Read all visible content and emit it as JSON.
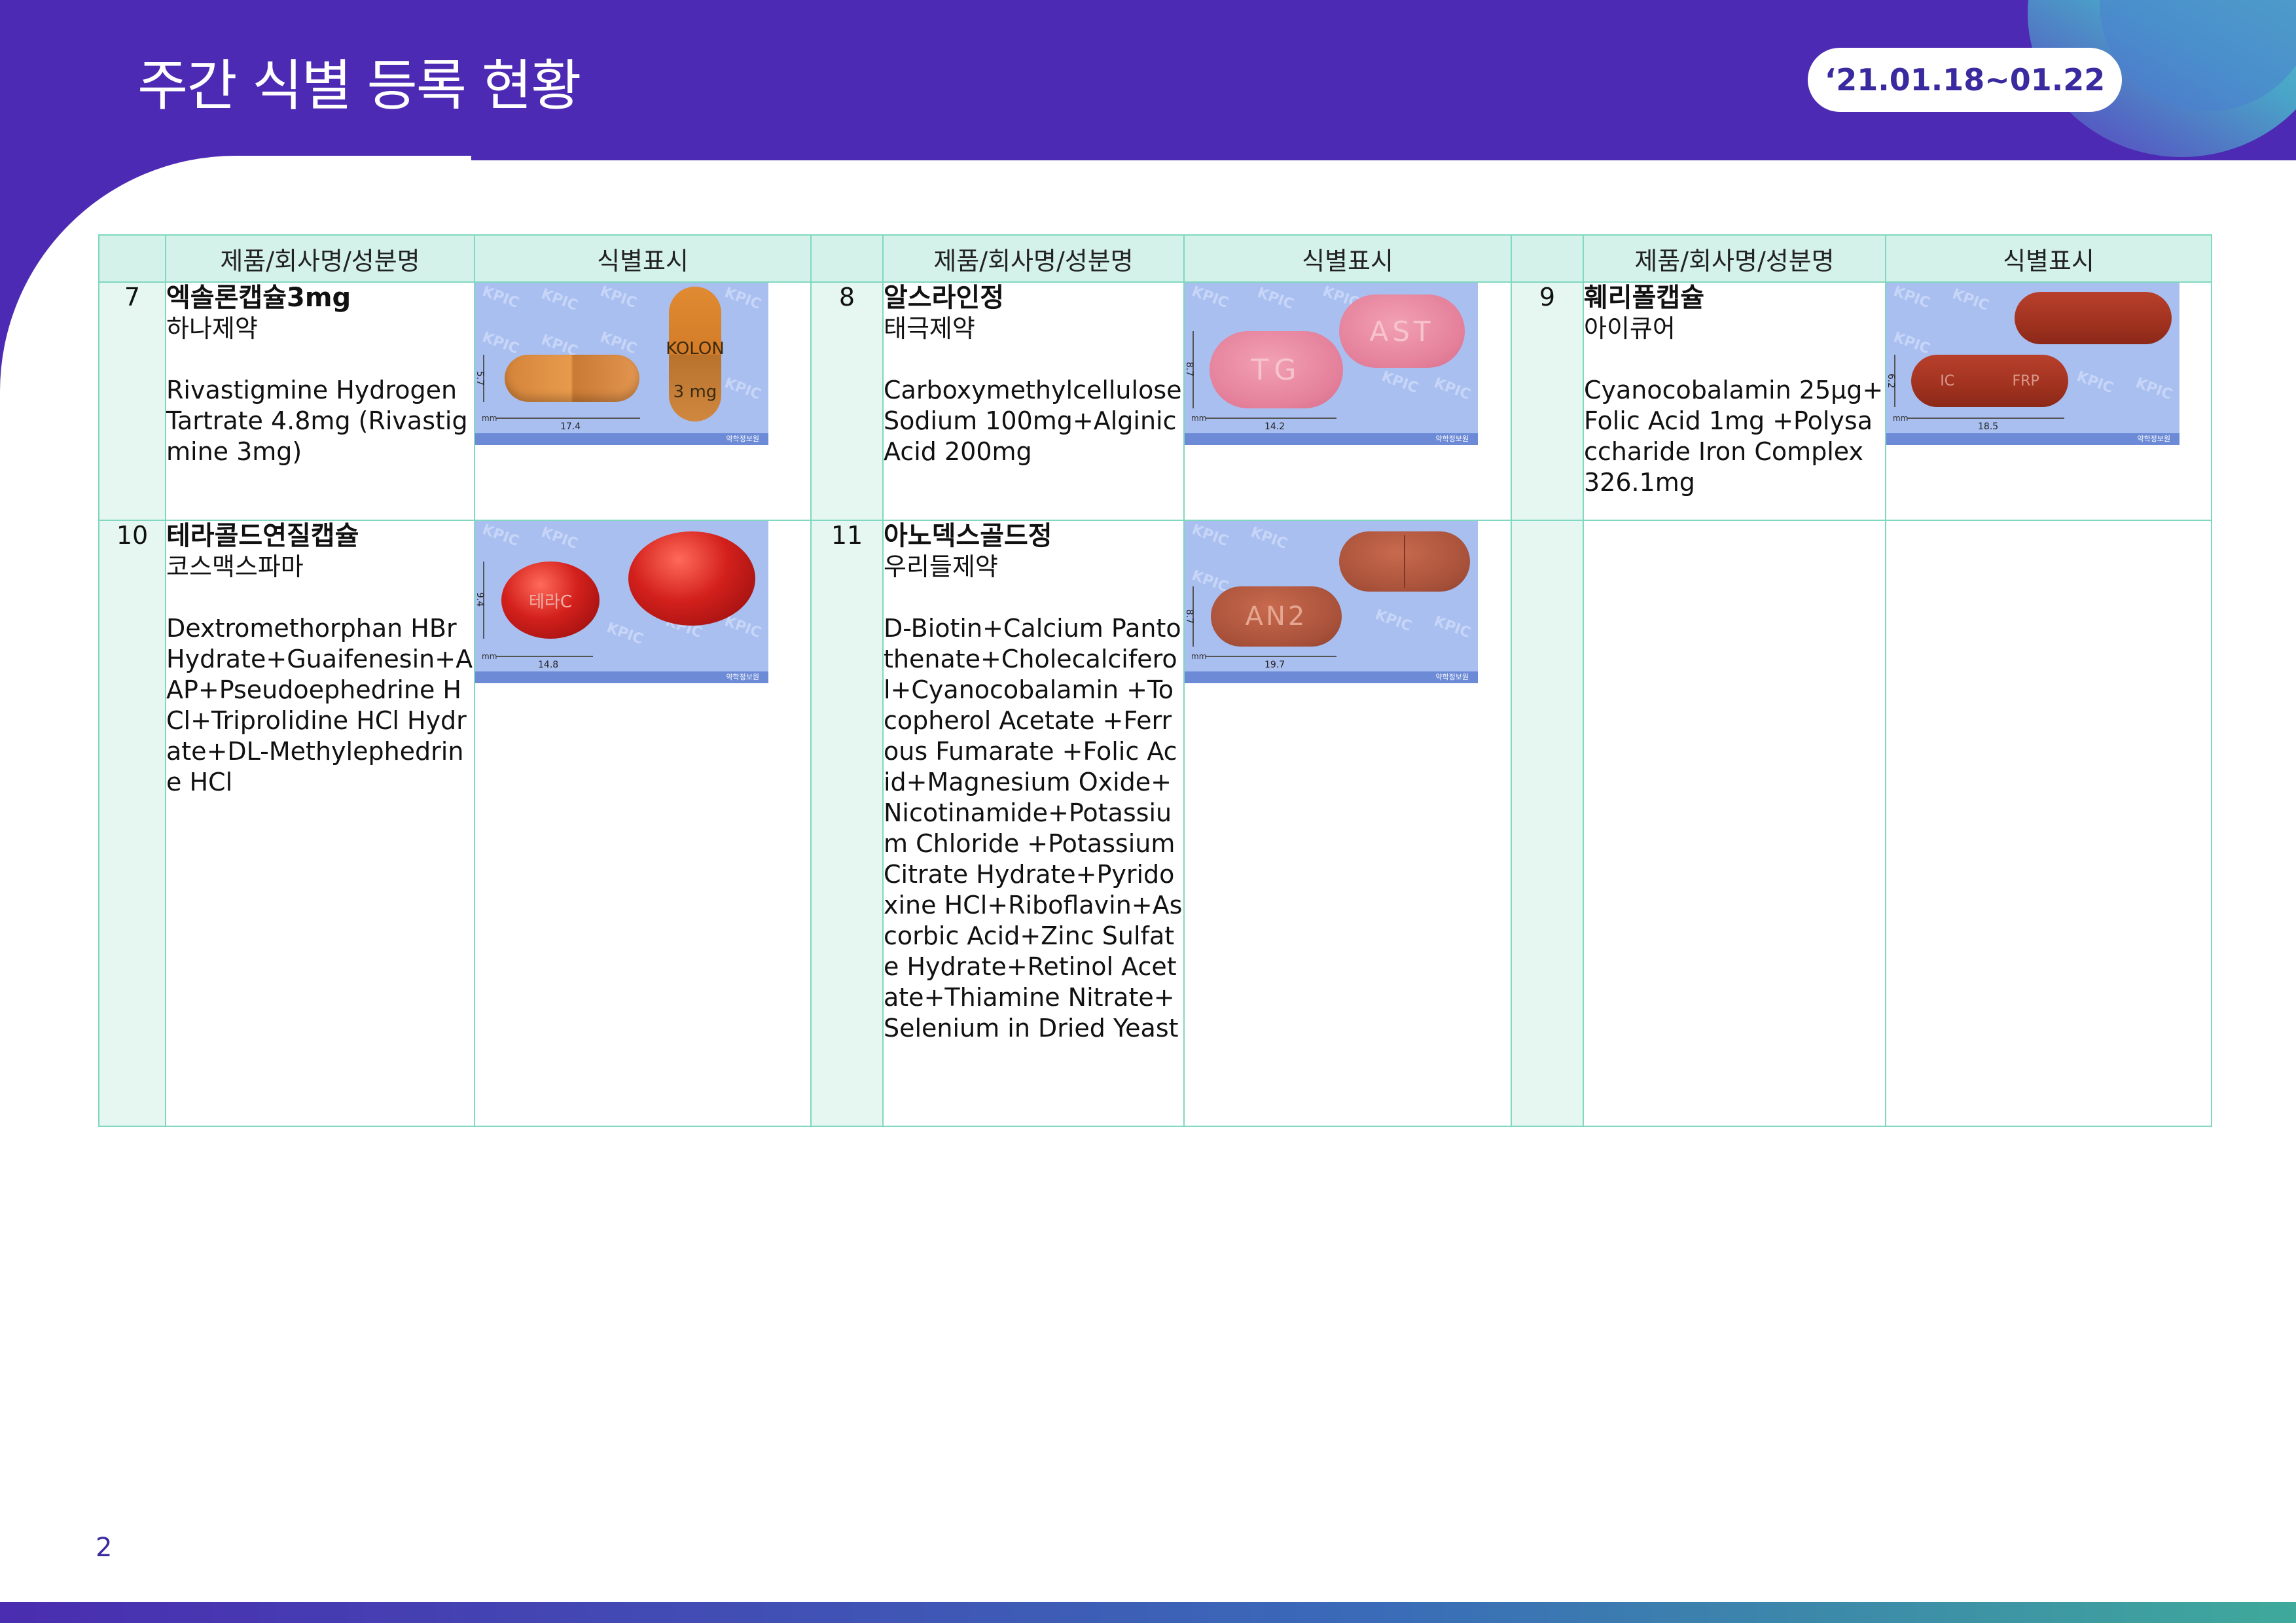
{
  "header": {
    "title": "주간 식별 등록 현황",
    "date_range": "‘21.01.18~01.22"
  },
  "table": {
    "columns": [
      "제품/회사명/성분명",
      "식별표시",
      "제품/회사명/성분명",
      "식별표시",
      "제품/회사명/성분명",
      "식별표시"
    ],
    "rows": [
      [
        {
          "num": "7",
          "name": "엑솔론캡슐3mg",
          "company": "하나제약",
          "ingredients": "Rivastigmine Hydrogen Tartrate 4.8mg (Rivastigmine 3mg)",
          "image": {
            "wm": "KPIC",
            "mm": "mm",
            "w": "17.4",
            "h": "5.7",
            "mark1": "KOLON",
            "mark2": "3 mg",
            "footer": "약학정보원"
          }
        },
        {
          "num": "8",
          "name": "알스라인정",
          "company": "태극제약",
          "ingredients": "Carboxymethylcellulose Sodium 100mg+Alginic Acid 200mg",
          "image": {
            "wm": "KPIC",
            "mm": "mm",
            "w": "14.2",
            "h": "8.7",
            "mark1": "TG",
            "mark2": "AST",
            "footer": "약학정보원"
          }
        },
        {
          "num": "9",
          "name": "훼리폴캡슐",
          "company": "아이큐어",
          "ingredients": "Cyanocobalamin 25µg+Folic Acid 1mg +Polysaccharide Iron Complex 326.1mg",
          "image": {
            "wm": "KPIC",
            "mm": "mm",
            "w": "18.5",
            "h": "6.2",
            "mark1": "IC",
            "mark2": "FRP",
            "footer": "약학정보원"
          }
        }
      ],
      [
        {
          "num": "10",
          "name": "테라콜드연질캡슐",
          "company": "코스맥스파마",
          "ingredients": "Dextromethorphan HBr Hydrate+Guaifenesin+AAP+Pseudoephedrine HCl+Triprolidine HCl Hydrate+DL-Methylephedrine HCl",
          "image": {
            "wm": "KPIC",
            "mm": "mm",
            "w": "14.8",
            "h": "9.4",
            "mark1": "테라C",
            "footer": "약학정보원"
          }
        },
        {
          "num": "11",
          "name": "아노덱스골드정",
          "company": "우리들제약",
          "ingredients": "D-Biotin+Calcium Pantothenate+Cholecalciferol+Cyanocobalamin +Tocopherol Acetate +Ferrous Fumarate +Folic Acid+Magnesium Oxide+Nicotinamide+Potassium Chloride +Potassium Citrate Hydrate+Pyridoxine HCl+Riboflavin+Ascorbic Acid+Zinc Sulfate Hydrate+Retinol Acetate+Thiamine Nitrate+Selenium in Dried Yeast",
          "image": {
            "wm": "KPIC",
            "mm": "mm",
            "w": "19.7",
            "h": "8.7",
            "mark1": "AN2",
            "footer": "약학정보원"
          }
        }
      ]
    ]
  },
  "footer": {
    "page_number": "2"
  },
  "colors": {
    "header": "#4d2ab3",
    "table_border": "#7fd8bf",
    "table_header_bg": "#d4f2ea",
    "num_cell_bg": "#e6f7f1",
    "image_bg": "#a9bff0"
  }
}
